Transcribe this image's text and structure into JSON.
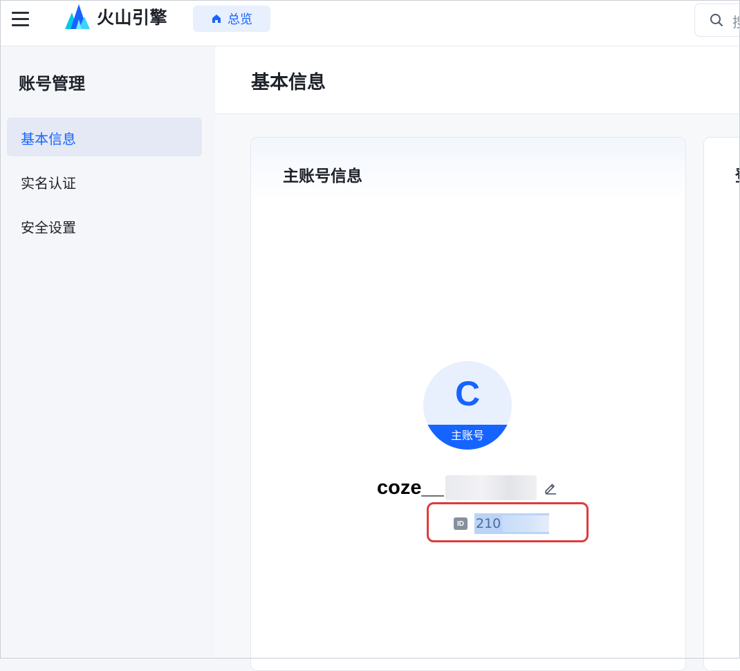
{
  "topbar": {
    "brand": "火山引擎",
    "overview_label": "总览",
    "search_placeholder": "搜"
  },
  "sidebar": {
    "title": "账号管理",
    "items": [
      {
        "label": "基本信息",
        "active": true
      },
      {
        "label": "实名认证",
        "active": false
      },
      {
        "label": "安全设置",
        "active": false
      }
    ]
  },
  "main": {
    "page_title": "基本信息",
    "card": {
      "title": "主账号信息",
      "avatar_letter": "C",
      "avatar_badge": "主账号",
      "username_prefix": "coze__",
      "id_tag": "ID",
      "id_visible": "210"
    },
    "card2": {
      "title_partial": "登"
    }
  },
  "colors": {
    "accent": "#1664ff",
    "highlight_border": "#e03a3a",
    "sidebar_active_bg": "#e4e9f5"
  },
  "icons": [
    "menu-icon",
    "volcano-logo-icon",
    "home-icon",
    "search-icon",
    "edit-icon",
    "id-tag-icon"
  ]
}
